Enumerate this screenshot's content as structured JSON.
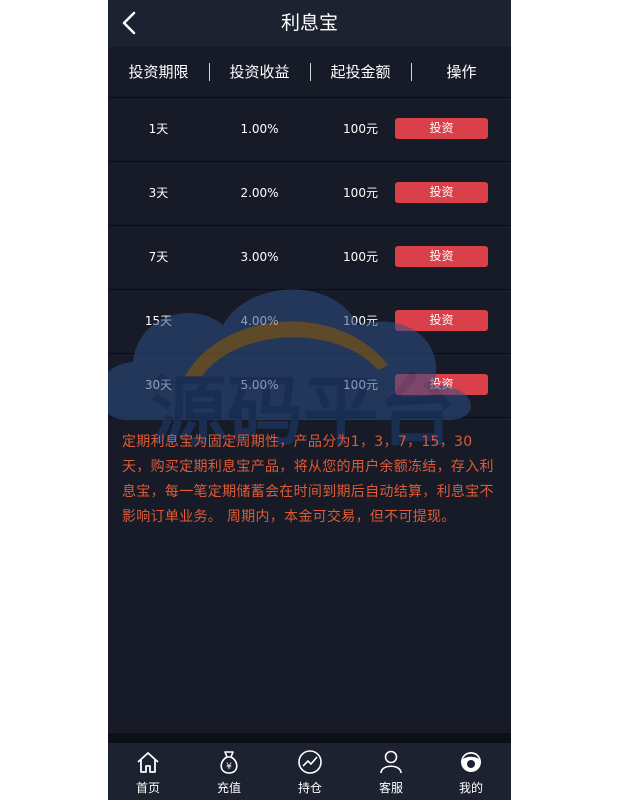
{
  "header": {
    "title": "利息宝"
  },
  "table": {
    "columns": [
      "投资期限",
      "投资收益",
      "起投金额",
      "操作"
    ],
    "rows": [
      {
        "term": "1天",
        "rate": "1.00%",
        "min": "100元",
        "action": "投资"
      },
      {
        "term": "3天",
        "rate": "2.00%",
        "min": "100元",
        "action": "投资"
      },
      {
        "term": "7天",
        "rate": "3.00%",
        "min": "100元",
        "action": "投资"
      },
      {
        "term": "15天",
        "rate": "4.00%",
        "min": "100元",
        "action": "投资"
      },
      {
        "term": "30天",
        "rate": "5.00%",
        "min": "100元",
        "action": "投资"
      }
    ]
  },
  "description": "定期利息宝为固定周期性，产品分为1，3，7，15，30天，购买定期利息宝产品，将从您的用户余额冻结，存入利息宝，每一笔定期储蓄会在时间到期后自动结算，利息宝不影响订单业务。 周期内，本金可交易，但不可提现。",
  "watermark": {
    "text": "源码平台"
  },
  "tabbar": {
    "items": [
      {
        "label": "首页",
        "icon": "home-icon"
      },
      {
        "label": "充值",
        "icon": "money-bag-icon"
      },
      {
        "label": "持仓",
        "icon": "chart-trend-icon"
      },
      {
        "label": "客服",
        "icon": "person-icon"
      },
      {
        "label": "我的",
        "icon": "avatar-icon"
      }
    ]
  },
  "colors": {
    "background": "#161b27",
    "header": "#1d2230",
    "button": "#d9404a",
    "description": "#e05a36"
  }
}
